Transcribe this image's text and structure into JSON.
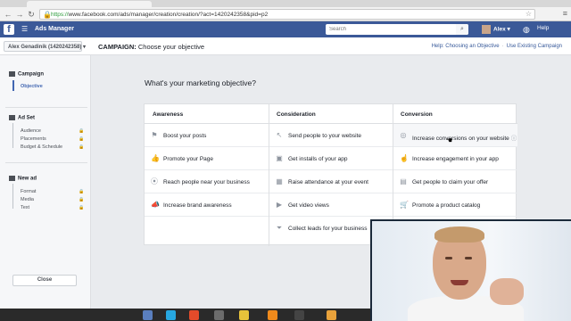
{
  "browser": {
    "url_secure": "https://",
    "url_rest": "www.facebook.com/ads/manager/creation/creation/?act=1420242358&pid=p2"
  },
  "fbbar": {
    "logo": "f",
    "title": "Ads Manager",
    "search_placeholder": "Search",
    "user_name": "Alex",
    "help": "Help"
  },
  "campaign_header": {
    "account": "Alex Genadinik (1420242358) ▾",
    "title_bold": "CAMPAIGN:",
    "title_rest": "Choose your objective",
    "link_help": "Help: Choosing an Objective",
    "link_existing": "Use Existing Campaign"
  },
  "sidebar": {
    "campaign": {
      "label": "Campaign",
      "items": [
        "Objective"
      ]
    },
    "adset": {
      "label": "Ad Set",
      "items": [
        "Audience",
        "Placements",
        "Budget & Schedule"
      ]
    },
    "ad": {
      "label": "New ad",
      "items": [
        "Format",
        "Media",
        "Text"
      ]
    },
    "close": "Close"
  },
  "main": {
    "question": "What's your marketing objective?",
    "columns": [
      {
        "header": "Awareness",
        "options": [
          {
            "icon": "flag-icon",
            "label": "Boost your posts"
          },
          {
            "icon": "thumbs-up-icon",
            "label": "Promote your Page"
          },
          {
            "icon": "location-pin-icon",
            "label": "Reach people near your business"
          },
          {
            "icon": "megaphone-icon",
            "label": "Increase brand awareness"
          }
        ]
      },
      {
        "header": "Consideration",
        "options": [
          {
            "icon": "cursor-icon",
            "label": "Send people to your website"
          },
          {
            "icon": "box-icon",
            "label": "Get installs of your app"
          },
          {
            "icon": "calendar-icon",
            "label": "Raise attendance at your event"
          },
          {
            "icon": "video-camera-icon",
            "label": "Get video views"
          },
          {
            "icon": "funnel-icon",
            "label": "Collect leads for your business"
          }
        ]
      },
      {
        "header": "Conversion",
        "options": [
          {
            "icon": "globe-icon",
            "label": "Increase conversions on your website"
          },
          {
            "icon": "pointer-icon",
            "label": "Increase engagement in your app"
          },
          {
            "icon": "tag-icon",
            "label": "Get people to claim your offer"
          },
          {
            "icon": "cart-icon",
            "label": "Promote a product catalog"
          }
        ]
      }
    ]
  },
  "colors": {
    "fb_blue": "#3b5998",
    "link_blue": "#365899",
    "active": "#4267b2"
  }
}
